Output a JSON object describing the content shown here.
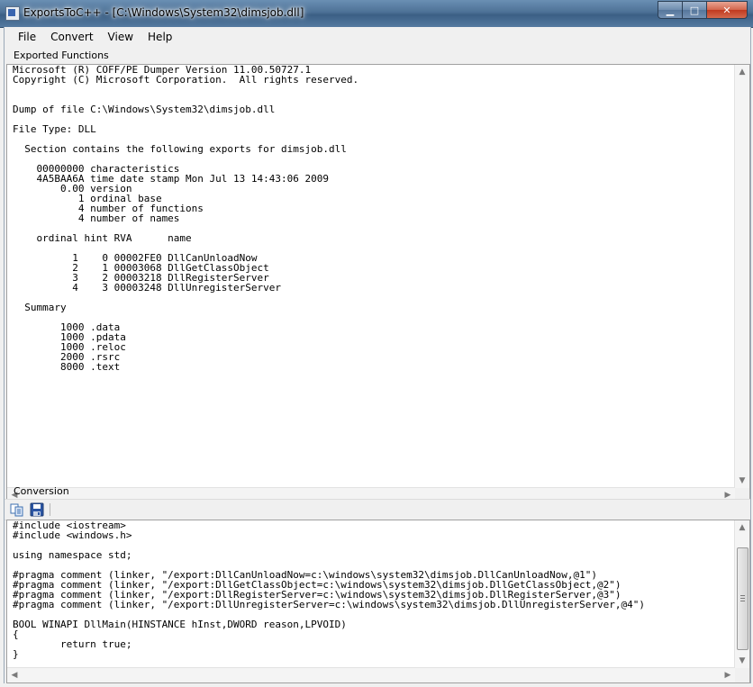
{
  "window": {
    "title": "ExportsToC++ - [C:\\Windows\\System32\\dimsjob.dll]",
    "controls": {
      "minimize": "▁",
      "maximize": "□",
      "close": "✕"
    }
  },
  "menu": {
    "items": [
      {
        "label": "File"
      },
      {
        "label": "Convert"
      },
      {
        "label": "View"
      },
      {
        "label": "Help"
      }
    ]
  },
  "exported_functions": {
    "label": "Exported Functions",
    "lines": [
      "Microsoft (R) COFF/PE Dumper Version 11.00.50727.1",
      "Copyright (C) Microsoft Corporation.  All rights reserved.",
      "",
      "",
      "Dump of file C:\\Windows\\System32\\dimsjob.dll",
      "",
      "File Type: DLL",
      "",
      "  Section contains the following exports for dimsjob.dll",
      "",
      "    00000000 characteristics",
      "    4A5BAA6A time date stamp Mon Jul 13 14:43:06 2009",
      "        0.00 version",
      "           1 ordinal base",
      "           4 number of functions",
      "           4 number of names",
      "",
      "    ordinal hint RVA      name",
      "",
      "          1    0 00002FE0 DllCanUnloadNow",
      "          2    1 00003068 DllGetClassObject",
      "          3    2 00003218 DllRegisterServer",
      "          4    3 00003248 DllUnregisterServer",
      "",
      "  Summary",
      "",
      "        1000 .data",
      "        1000 .pdata",
      "        1000 .reloc",
      "        2000 .rsrc",
      "        8000 .text"
    ]
  },
  "conversion": {
    "label": "Conversion",
    "toolbar": {
      "copy_icon": "copy-icon",
      "save_icon": "save-icon"
    },
    "lines": [
      "#include <iostream>",
      "#include <windows.h>",
      "",
      "using namespace std;",
      "",
      "#pragma comment (linker, \"/export:DllCanUnloadNow=c:\\windows\\system32\\dimsjob.DllCanUnloadNow,@1\")",
      "#pragma comment (linker, \"/export:DllGetClassObject=c:\\windows\\system32\\dimsjob.DllGetClassObject,@2\")",
      "#pragma comment (linker, \"/export:DllRegisterServer=c:\\windows\\system32\\dimsjob.DllRegisterServer,@3\")",
      "#pragma comment (linker, \"/export:DllUnregisterServer=c:\\windows\\system32\\dimsjob.DllUnregisterServer,@4\")",
      "",
      "BOOL WINAPI DllMain(HINSTANCE hInst,DWORD reason,LPVOID)",
      "{",
      "        return true;",
      "}"
    ]
  }
}
